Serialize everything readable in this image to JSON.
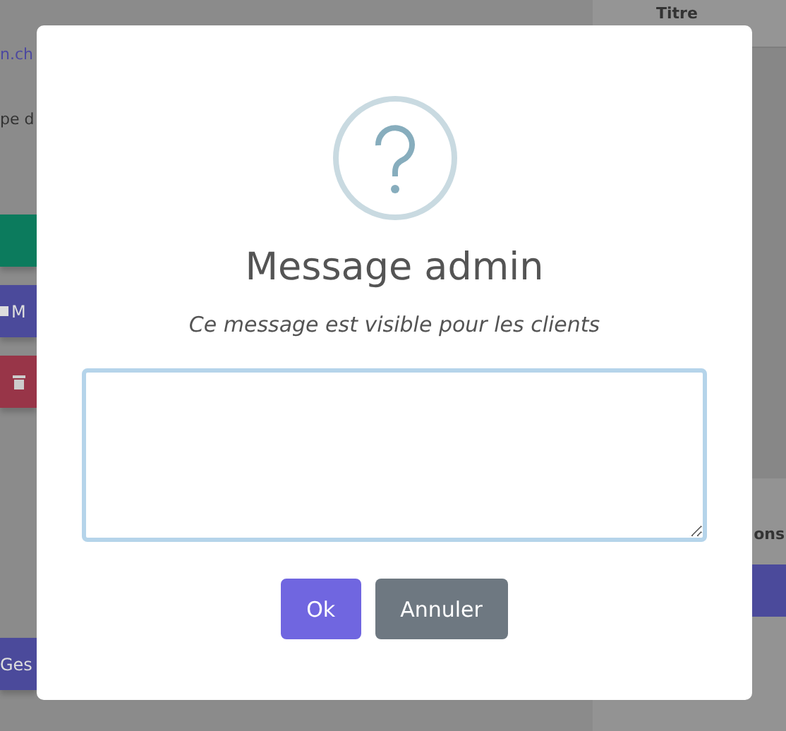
{
  "background": {
    "left": [
      {
        "kind": "link",
        "text": "n.ch"
      },
      {
        "kind": "text",
        "text": "pe d"
      },
      {
        "kind": "button",
        "color": "#0c7b5d"
      },
      {
        "kind": "button",
        "color": "#4b4a9b",
        "text": "M"
      },
      {
        "kind": "button",
        "color": "#983548"
      },
      {
        "kind": "button",
        "color": "#4b4a9b",
        "text": "Ges"
      }
    ],
    "right": {
      "header": "Titre",
      "label": "ons"
    }
  },
  "dialog": {
    "title": "Message admin",
    "subtitle": "Ce message est visible pour les clients",
    "buttons": [
      {
        "label": "Ok",
        "kind": "confirm"
      },
      {
        "label": "Annuler",
        "kind": "cancel"
      }
    ]
  }
}
